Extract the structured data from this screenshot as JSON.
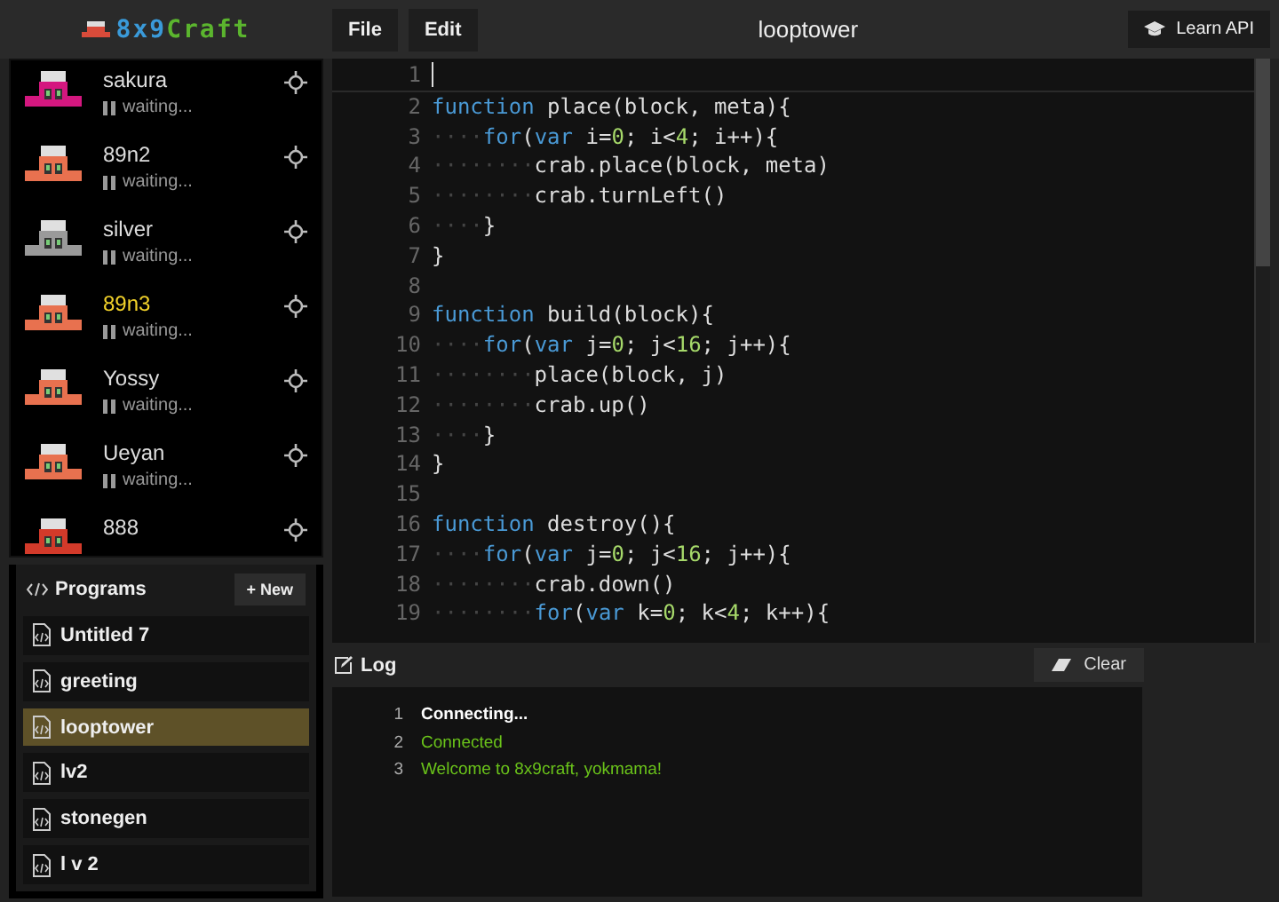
{
  "logo": {
    "parts": [
      {
        "text": "8x9",
        "color": "#3a9ad9"
      },
      {
        "text": "Craft",
        "color": "#5bb52e"
      }
    ]
  },
  "menu": [
    "File",
    "Edit"
  ],
  "title": "looptower",
  "learn_button": "Learn API",
  "crabs": [
    {
      "name": "sakura",
      "status": "waiting...",
      "selected": false,
      "color": "#d4177f"
    },
    {
      "name": "89n2",
      "status": "waiting...",
      "selected": false,
      "color": "#e8714f"
    },
    {
      "name": "silver",
      "status": "waiting...",
      "selected": false,
      "color": "#9a9a9a"
    },
    {
      "name": "89n3",
      "status": "waiting...",
      "selected": true,
      "color": "#e8714f"
    },
    {
      "name": "Yossy",
      "status": "waiting...",
      "selected": false,
      "color": "#e8714f"
    },
    {
      "name": "Ueyan",
      "status": "waiting...",
      "selected": false,
      "color": "#e8714f"
    },
    {
      "name": "888",
      "selected": false,
      "color": "#d33a2a"
    }
  ],
  "programs": {
    "title": "Programs",
    "new_button": "+ New",
    "items": [
      {
        "name": "Untitled 7",
        "selected": false
      },
      {
        "name": "greeting",
        "selected": false
      },
      {
        "name": "looptower",
        "selected": true
      },
      {
        "name": "lv2",
        "selected": false
      },
      {
        "name": "stonegen",
        "selected": false
      },
      {
        "name": "l v 2",
        "selected": false
      }
    ]
  },
  "editor": {
    "lines": [
      {
        "number": "1"
      },
      {
        "number": "2",
        "tokens": [
          {
            "kind": "keyword",
            "text": "function"
          },
          {
            "kind": "plain",
            "text": " place(block, meta){"
          }
        ]
      },
      {
        "number": "3",
        "tokens": [
          {
            "kind": "indent",
            "text": "····"
          },
          {
            "kind": "keyword",
            "text": "for"
          },
          {
            "kind": "plain",
            "text": "("
          },
          {
            "kind": "keyword",
            "text": "var"
          },
          {
            "kind": "plain",
            "text": " i="
          },
          {
            "kind": "number",
            "text": "0"
          },
          {
            "kind": "plain",
            "text": "; i<"
          },
          {
            "kind": "number",
            "text": "4"
          },
          {
            "kind": "plain",
            "text": "; i++){"
          }
        ]
      },
      {
        "number": "4",
        "tokens": [
          {
            "kind": "indent",
            "text": "········"
          },
          {
            "kind": "plain",
            "text": "crab.place(block, meta)"
          }
        ]
      },
      {
        "number": "5",
        "tokens": [
          {
            "kind": "indent",
            "text": "········"
          },
          {
            "kind": "plain",
            "text": "crab.turnLeft()"
          }
        ]
      },
      {
        "number": "6",
        "tokens": [
          {
            "kind": "indent",
            "text": "····"
          },
          {
            "kind": "plain",
            "text": "}"
          }
        ]
      },
      {
        "number": "7",
        "tokens": [
          {
            "kind": "plain",
            "text": "}"
          }
        ]
      },
      {
        "number": "8"
      },
      {
        "number": "9",
        "tokens": [
          {
            "kind": "keyword",
            "text": "function"
          },
          {
            "kind": "plain",
            "text": " build(block){"
          }
        ]
      },
      {
        "number": "10",
        "tokens": [
          {
            "kind": "indent",
            "text": "····"
          },
          {
            "kind": "keyword",
            "text": "for"
          },
          {
            "kind": "plain",
            "text": "("
          },
          {
            "kind": "keyword",
            "text": "var"
          },
          {
            "kind": "plain",
            "text": " j="
          },
          {
            "kind": "number",
            "text": "0"
          },
          {
            "kind": "plain",
            "text": "; j<"
          },
          {
            "kind": "number",
            "text": "16"
          },
          {
            "kind": "plain",
            "text": "; j++){"
          }
        ]
      },
      {
        "number": "11",
        "tokens": [
          {
            "kind": "indent",
            "text": "········"
          },
          {
            "kind": "plain",
            "text": "place(block, j)"
          }
        ]
      },
      {
        "number": "12",
        "tokens": [
          {
            "kind": "indent",
            "text": "········"
          },
          {
            "kind": "plain",
            "text": "crab.up()"
          }
        ]
      },
      {
        "number": "13",
        "tokens": [
          {
            "kind": "indent",
            "text": "····"
          },
          {
            "kind": "plain",
            "text": "}"
          }
        ]
      },
      {
        "number": "14",
        "tokens": [
          {
            "kind": "plain",
            "text": "}"
          }
        ]
      },
      {
        "number": "15"
      },
      {
        "number": "16",
        "tokens": [
          {
            "kind": "keyword",
            "text": "function"
          },
          {
            "kind": "plain",
            "text": " destroy(){"
          }
        ]
      },
      {
        "number": "17",
        "tokens": [
          {
            "kind": "indent",
            "text": "····"
          },
          {
            "kind": "keyword",
            "text": "for"
          },
          {
            "kind": "plain",
            "text": "("
          },
          {
            "kind": "keyword",
            "text": "var"
          },
          {
            "kind": "plain",
            "text": " j="
          },
          {
            "kind": "number",
            "text": "0"
          },
          {
            "kind": "plain",
            "text": "; j<"
          },
          {
            "kind": "number",
            "text": "16"
          },
          {
            "kind": "plain",
            "text": "; j++){"
          }
        ]
      },
      {
        "number": "18",
        "tokens": [
          {
            "kind": "indent",
            "text": "········"
          },
          {
            "kind": "plain",
            "text": "crab.down()"
          }
        ]
      },
      {
        "number": "19",
        "tokens": [
          {
            "kind": "indent",
            "text": "········"
          },
          {
            "kind": "keyword",
            "text": "for"
          },
          {
            "kind": "plain",
            "text": "("
          },
          {
            "kind": "keyword",
            "text": "var"
          },
          {
            "kind": "plain",
            "text": " k="
          },
          {
            "kind": "number",
            "text": "0"
          },
          {
            "kind": "plain",
            "text": "; k<"
          },
          {
            "kind": "number",
            "text": "4"
          },
          {
            "kind": "plain",
            "text": "; k++){"
          }
        ]
      }
    ]
  },
  "log": {
    "title": "Log",
    "clear_button": "Clear",
    "lines": [
      {
        "number": "1",
        "kind": "info",
        "text": "Connecting..."
      },
      {
        "number": "2",
        "kind": "success",
        "text": "Connected"
      },
      {
        "number": "3",
        "kind": "success",
        "text": "Welcome to 8x9craft, yokmama!"
      }
    ]
  }
}
